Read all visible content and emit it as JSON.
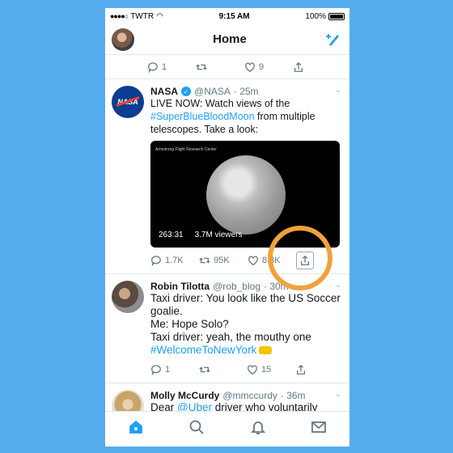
{
  "status_bar": {
    "carrier": "TWTR",
    "time": "9:15 AM",
    "battery": "100%"
  },
  "nav": {
    "title": "Home"
  },
  "prev_tweet": {
    "replies": "1",
    "retweets": "",
    "likes": "9"
  },
  "tweets": [
    {
      "name": "NASA",
      "handle": "@NASA",
      "time": "· 25m",
      "text_1": "LIVE NOW: Watch views of the",
      "hashtag": "#SuperBlueBloodMoon",
      "text_2": " from multiple telescopes. Take a look:",
      "video": {
        "caption": "Armstrong Flight Research Center",
        "duration": "263:31",
        "viewers": "3.7M viewers"
      },
      "replies": "1.7K",
      "retweets": "95K",
      "likes": "8.8K"
    },
    {
      "name": "Robin Tilotta",
      "handle": "@rob_blog",
      "time": "· 30m",
      "lines": [
        "Taxi driver: You look like the US Soccer goalie.",
        "Me: Hope Solo?",
        "Taxi driver: yeah, the mouthy one"
      ],
      "hashtag": "#WelcomeToNewYork",
      "replies": "1",
      "retweets": "",
      "likes": "15"
    },
    {
      "name": "Molly McCurdy",
      "handle": "@mmccurdy",
      "time": "· 36m",
      "text_1": "Dear ",
      "mention": "@Uber",
      "text_2": " driver who voluntarily came back to return my new under eye"
    }
  ],
  "tabs": [
    "home",
    "search",
    "notifications",
    "messages"
  ],
  "colors": {
    "background": "#55acee",
    "accent": "#1da1f2",
    "highlight_ring": "#f0a23d"
  }
}
